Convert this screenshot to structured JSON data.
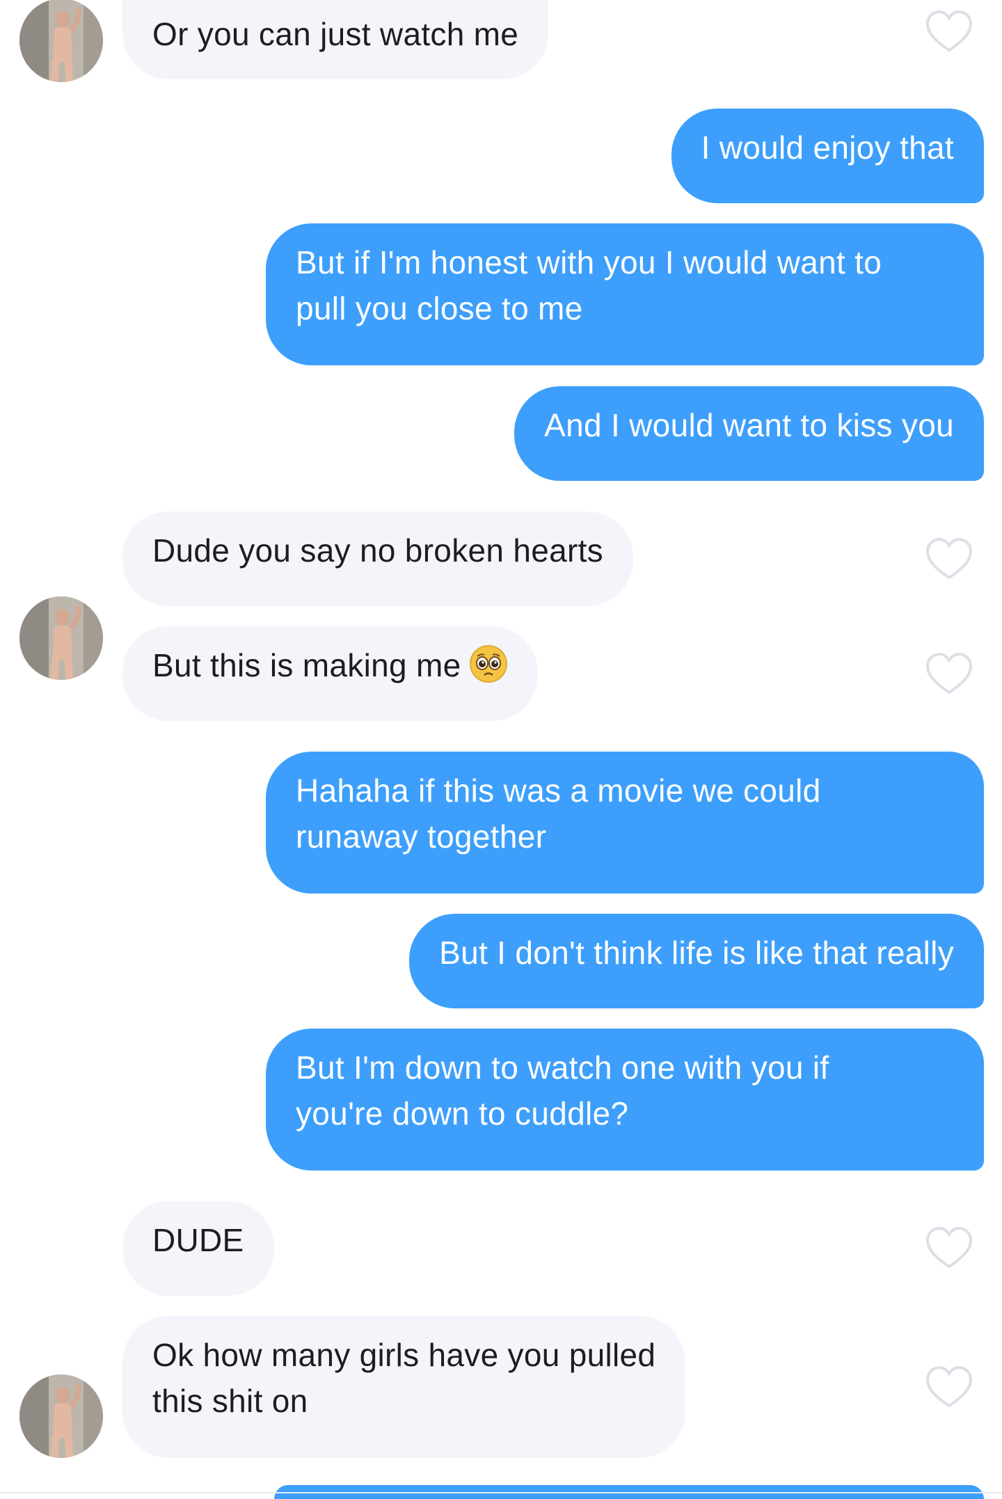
{
  "conversation": {
    "messages": [
      {
        "sender": "them",
        "text": "Or you can just watch me"
      },
      {
        "sender": "me",
        "text": "I would enjoy that"
      },
      {
        "sender": "me",
        "line1": "But if I'm honest with you I would want to",
        "line2": "pull you close to me"
      },
      {
        "sender": "me",
        "text": "And I would want to kiss you"
      },
      {
        "sender": "them",
        "text": "Dude you say no broken hearts"
      },
      {
        "sender": "them",
        "text": "But this is making me",
        "emoji": "pleading-face-emoji"
      },
      {
        "sender": "me",
        "line1": "Hahaha if this was a movie we could",
        "line2": "runaway together"
      },
      {
        "sender": "me",
        "text": "But I don't think life is like that really"
      },
      {
        "sender": "me",
        "line1": "But I'm down to watch one with you if",
        "line2": "you're down to cuddle?"
      },
      {
        "sender": "them",
        "text": "DUDE"
      },
      {
        "sender": "them",
        "line1": "Ok how many girls have you pulled",
        "line2": "this shit on"
      }
    ]
  },
  "icons": {
    "like": "heart-outline-icon",
    "avatar": "profile-avatar"
  },
  "colors": {
    "outgoing_bubble": "#3d9ffb",
    "incoming_bubble": "#f3f5fa",
    "incoming_text": "#1d1d1f",
    "outgoing_text": "#ffffff",
    "heart_outline": "#dcdfe6"
  }
}
